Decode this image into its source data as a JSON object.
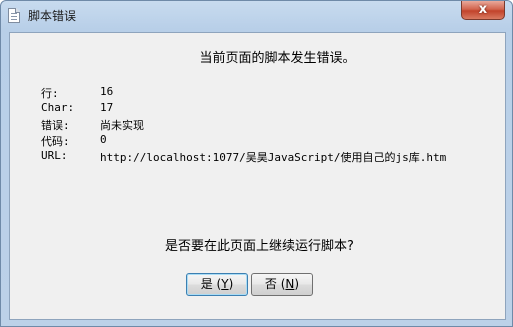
{
  "window": {
    "title": "脚本错误",
    "close_glyph": "x"
  },
  "dialog": {
    "headline": "当前页面的脚本发生错误。",
    "details": [
      {
        "label": "行:",
        "value": "16"
      },
      {
        "label": "Char:",
        "value": "17"
      },
      {
        "label": "错误:",
        "value": "尚未实现"
      },
      {
        "label": "代码:",
        "value": "0"
      },
      {
        "label": "URL:",
        "value": "http://localhost:1077/吴昊JavaScript/使用自己的js库.htm"
      }
    ],
    "question": "是否要在此页面上继续运行脚本?",
    "yes_button": {
      "label": "是",
      "accel": "Y"
    },
    "no_button": {
      "label": "否",
      "accel": "N"
    }
  }
}
